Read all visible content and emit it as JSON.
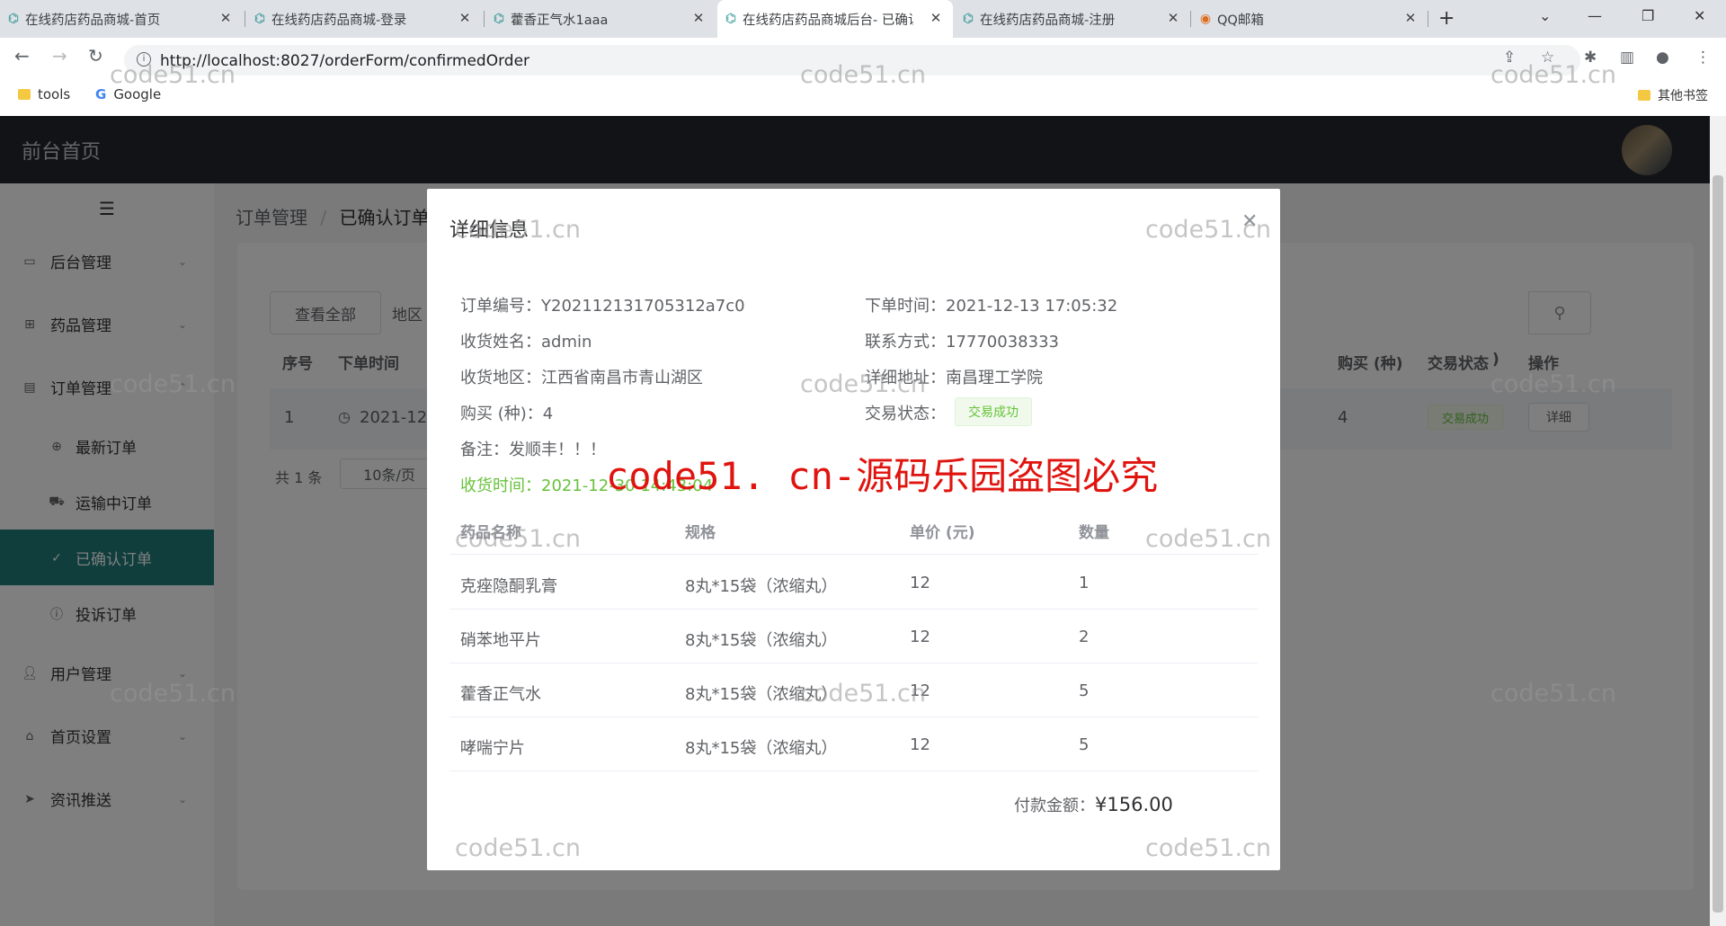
{
  "browser": {
    "tabs": [
      {
        "title": "在线药店药品商城-首页"
      },
      {
        "title": "在线药店药品商城-登录"
      },
      {
        "title": "藿香正气水1aaa"
      },
      {
        "title": "在线药店药品商城后台- 已确认订单"
      },
      {
        "title": "在线药店药品商城-注册"
      },
      {
        "title": "QQ邮箱"
      }
    ],
    "url": "http://localhost:8027/orderForm/confirmedOrder",
    "bookmarks": [
      "tools",
      "Google"
    ],
    "other_bookmarks": "其他书签"
  },
  "app": {
    "brand": "前台首页"
  },
  "sidebar": {
    "menus": [
      {
        "label": "后台管理",
        "icon": "briefcase-icon"
      },
      {
        "label": "药品管理",
        "icon": "medical-kit-icon"
      },
      {
        "label": "订单管理",
        "icon": "document-icon"
      },
      {
        "label": "最新订单",
        "icon": "file-plus-icon"
      },
      {
        "label": "运输中订单",
        "icon": "truck-icon"
      },
      {
        "label": "已确认订单",
        "icon": "check-list-icon"
      },
      {
        "label": "投诉订单",
        "icon": "warning-circle-icon"
      },
      {
        "label": "用户管理",
        "icon": "user-icon"
      },
      {
        "label": "首页设置",
        "icon": "home-icon"
      },
      {
        "label": "资讯推送",
        "icon": "send-icon"
      }
    ]
  },
  "page": {
    "breadcrumb": [
      "订单管理",
      "已确认订单"
    ],
    "view_all_label": "查看全部",
    "filter_label": "地区",
    "table_headers": [
      "序号",
      "下单时间",
      "购买 (种)",
      "交易状态",
      "操作"
    ],
    "header_fragment": ")",
    "row": {
      "index": "1",
      "time": "2021-12-",
      "count": "4",
      "status": "交易成功",
      "action": "详细"
    },
    "pagination": {
      "total": "共 1 条",
      "page_size": "10条/页"
    }
  },
  "dialog": {
    "title": "详细信息",
    "fields": {
      "order_no_label": "订单编号：",
      "order_no": "Y202112131705312a7c0",
      "order_time_label": "下单时间：",
      "order_time": "2021-12-13 17:05:32",
      "name_label": "收货姓名：",
      "name": "admin",
      "phone_label": "联系方式：",
      "phone": "17770038333",
      "region_label": "收货地区：",
      "region": "江西省南昌市青山湖区",
      "address_label": "详细地址：",
      "address": "南昌理工学院",
      "count_label": "购买 (种)：",
      "count": "4",
      "status_label": "交易状态：",
      "status": "交易成功",
      "remark_label": "备注：",
      "remark": "发顺丰！！！",
      "receive_label": "收货时间：",
      "receive": "2021-12-30 14:43:04"
    },
    "table_headers": [
      "药品名称",
      "规格",
      "单价 (元)",
      "数量"
    ],
    "items": [
      {
        "name": "克痤隐酮乳膏",
        "spec": "8丸*15袋（浓缩丸）",
        "price": "12",
        "qty": "1"
      },
      {
        "name": "硝苯地平片",
        "spec": "8丸*15袋（浓缩丸）",
        "price": "12",
        "qty": "2"
      },
      {
        "name": "藿香正气水",
        "spec": "8丸*15袋（浓缩丸）",
        "price": "12",
        "qty": "5"
      },
      {
        "name": "哮喘宁片",
        "spec": "8丸*15袋（浓缩丸）",
        "price": "12",
        "qty": "5"
      }
    ],
    "total_label": "付款金额：",
    "total": "¥156.00"
  },
  "watermark": {
    "text": "code51.cn",
    "banner": "code51. cn-源码乐园盗图必究"
  },
  "colors": {
    "topbar": "#23262e",
    "sidebar_active": "#1f7c7a",
    "success": "#67c23a",
    "watermark_red": "#e0140f"
  }
}
